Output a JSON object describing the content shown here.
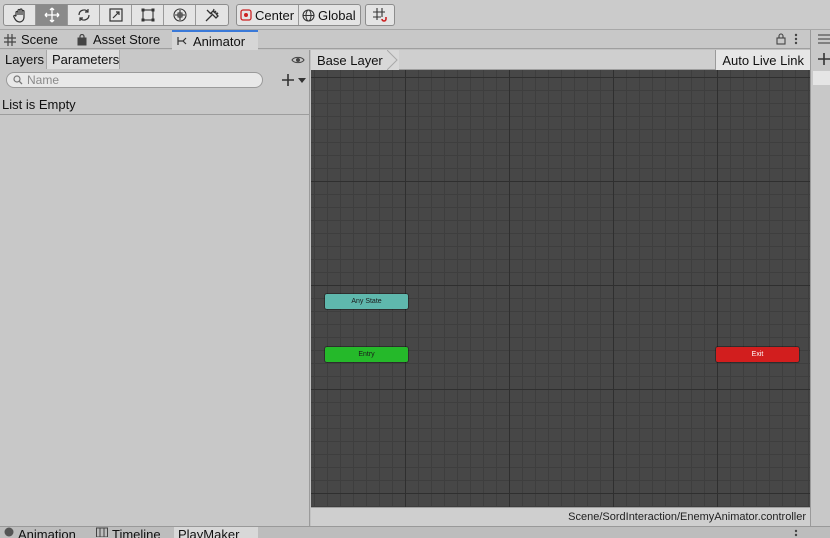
{
  "toolbar": {
    "pivot_center_label": "Center",
    "pivot_global_label": "Global"
  },
  "tabs": {
    "scene": "Scene",
    "asset_store": "Asset Store",
    "animator": "Animator"
  },
  "left_panel": {
    "layers_tab": "Layers",
    "parameters_tab": "Parameters",
    "search_placeholder": "Name",
    "empty_text": "List is Empty"
  },
  "graph": {
    "breadcrumb": "Base Layer",
    "auto_live_link": "Auto Live Link",
    "nodes": {
      "any_state": "Any State",
      "entry": "Entry",
      "exit": "Exit"
    },
    "footer_path": "Scene/SordInteraction/EnemyAnimator.controller"
  },
  "bottom_tabs": {
    "animation": "Animation",
    "timeline": "Timeline",
    "playmaker": "PlayMaker"
  },
  "colors": {
    "any_state": "#5fb8ad",
    "entry": "#25b92a",
    "exit": "#d21e1e",
    "active_tab_accent": "#3a79d8"
  }
}
